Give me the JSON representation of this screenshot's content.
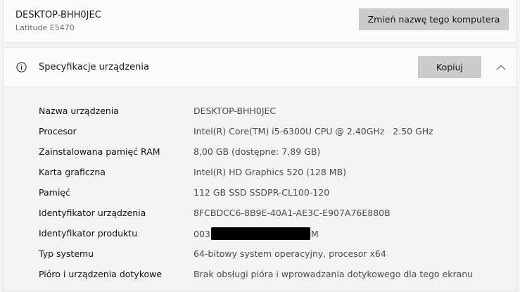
{
  "device": {
    "name": "DESKTOP-BHH0JEC",
    "model": "Latitude E5470",
    "rename_label": "Zmień nazwę tego komputera"
  },
  "specs": {
    "title": "Specyfikacje urządzenia",
    "copy_label": "Kopiuj",
    "rows": [
      {
        "label": "Nazwa urządzenia",
        "value": "DESKTOP-BHH0JEC"
      },
      {
        "label": "Procesor",
        "value": "Intel(R) Core(TM) i5-6300U CPU @ 2.40GHz   2.50 GHz"
      },
      {
        "label": "Zainstalowana pamięć RAM",
        "value": "8,00 GB (dostępne: 7,89 GB)"
      },
      {
        "label": "Karta graficzna",
        "value": "Intel(R) HD Graphics 520 (128 MB)"
      },
      {
        "label": "Pamięć",
        "value": "112 GB SSD SSDPR-CL100-120"
      },
      {
        "label": "Identyfikator urządzenia",
        "value": "8FCBDCC6-8B9E-40A1-AE3C-E907A76E880B"
      },
      {
        "label": "Identyfikator produktu",
        "value_prefix": "003",
        "value_suffix": "M"
      },
      {
        "label": "Typ systemu",
        "value": "64-bitowy system operacyjny, procesor x64"
      },
      {
        "label": "Pióro i urządzenia dotykowe",
        "value": "Brak obsługi pióra i wprowadzania dotykowego dla tego ekranu"
      }
    ]
  },
  "icons": {
    "info": "info-icon",
    "collapse": "chevron-up-icon"
  },
  "colors": {
    "page_background": "#f3f3f3",
    "card_background": "#fbfbfb",
    "button_background": "#cccccc",
    "value_text": "#4a4a4a",
    "redaction": "#000000"
  }
}
